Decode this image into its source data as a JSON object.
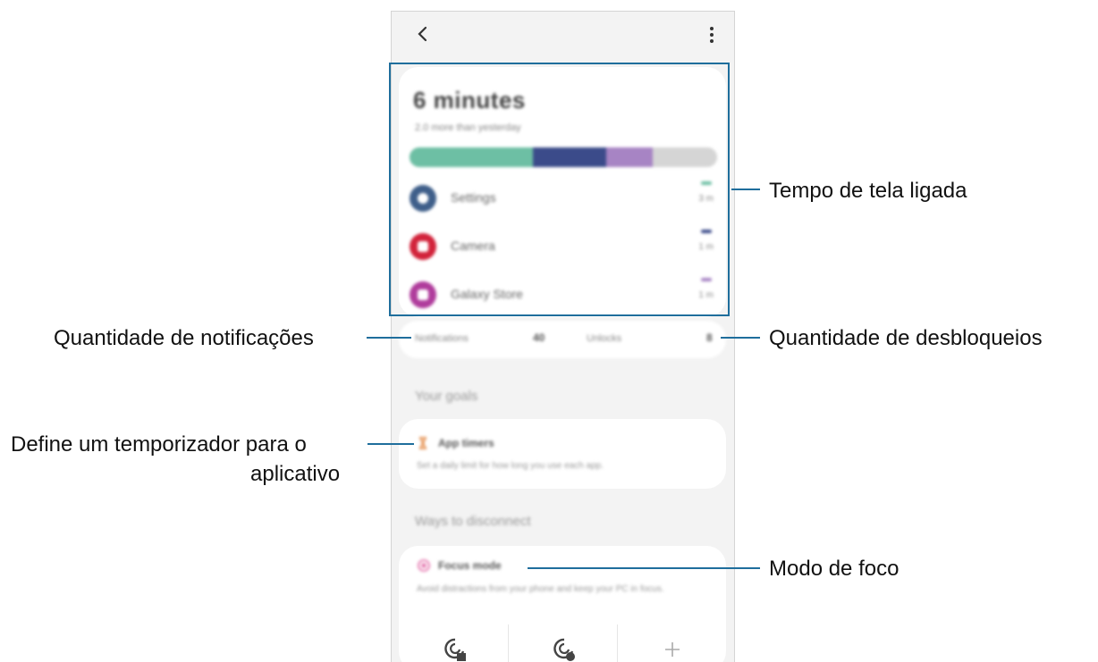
{
  "screen": {
    "total_time": "6 minutes",
    "subtitle": "2.0 more than yesterday",
    "usage_segments": [
      {
        "app": "Settings",
        "fraction": 0.4,
        "color": "#6dbfa4"
      },
      {
        "app": "Camera",
        "fraction": 0.24,
        "color": "#3b4b8a"
      },
      {
        "app": "Galaxy Store",
        "fraction": 0.15,
        "color": "#a784c4"
      },
      {
        "app": "Other",
        "fraction": 0.21,
        "color": "#d5d5d5"
      }
    ],
    "apps": [
      {
        "name": "Settings",
        "time": "3 m",
        "icon_color": "#3f5f8a",
        "dash_color": "#6dbfa4",
        "icon": "gear-icon"
      },
      {
        "name": "Camera",
        "time": "1 m",
        "icon_color": "#d2233b",
        "dash_color": "#3b4b8a",
        "icon": "camera-icon"
      },
      {
        "name": "Galaxy Store",
        "time": "1 m",
        "icon_color": "#b03c9c",
        "dash_color": "#a784c4",
        "icon": "store-icon"
      }
    ],
    "notifications_label": "Notifications",
    "notifications_count": "40",
    "unlocks_label": "Unlocks",
    "unlocks_count": "8",
    "goals_section": "Your goals",
    "app_timers_title": "App timers",
    "app_timers_desc": "Set a daily limit for how long you use each app.",
    "disconnect_section": "Ways to disconnect",
    "focus_title": "Focus mode",
    "focus_desc": "Avoid distractions from your phone and keep your PC in focus."
  },
  "callouts": {
    "screen_time": "Tempo de tela ligada",
    "notifications": "Quantidade de notificações",
    "unlocks": "Quantidade de desbloqueios",
    "timer_line1": "Define um temporizador para o",
    "timer_line2": "aplicativo",
    "focus": "Modo de foco"
  },
  "accent_color": "#1f6e9c"
}
